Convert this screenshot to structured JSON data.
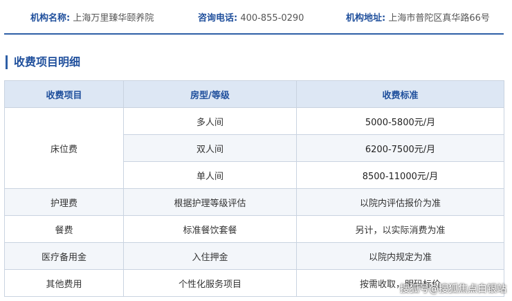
{
  "info": {
    "name_label": "机构名称:",
    "name_value": "上海万里臻华颐养院",
    "phone_label": "咨询电话:",
    "phone_value": "400-855-0290",
    "address_label": "机构地址:",
    "address_value": "上海市普陀区真华路66号"
  },
  "section_title": "收费项目明细",
  "table": {
    "headers": [
      "收费项目",
      "房型/等级",
      "收费标准"
    ],
    "bed": {
      "category": "床位费",
      "rows": [
        {
          "type": "多人间",
          "price": "5000-5800元/月"
        },
        {
          "type": "双人间",
          "price": "6200-7500元/月"
        },
        {
          "type": "单人间",
          "price": "8500-11000元/月"
        }
      ]
    },
    "rows": [
      {
        "item": "护理费",
        "level": "根据护理等级评估",
        "price": "以院内评估报价为准"
      },
      {
        "item": "餐费",
        "level": "标准餐饮套餐",
        "price": "另计，以实际消费为准"
      },
      {
        "item": "医疗备用金",
        "level": "入住押金",
        "price": "以院内规定为准"
      },
      {
        "item": "其他费用",
        "level": "个性化服务项目",
        "price": "按需收取，明码标价"
      }
    ]
  },
  "watermark": "搜狐号@搜狐焦点白银站"
}
